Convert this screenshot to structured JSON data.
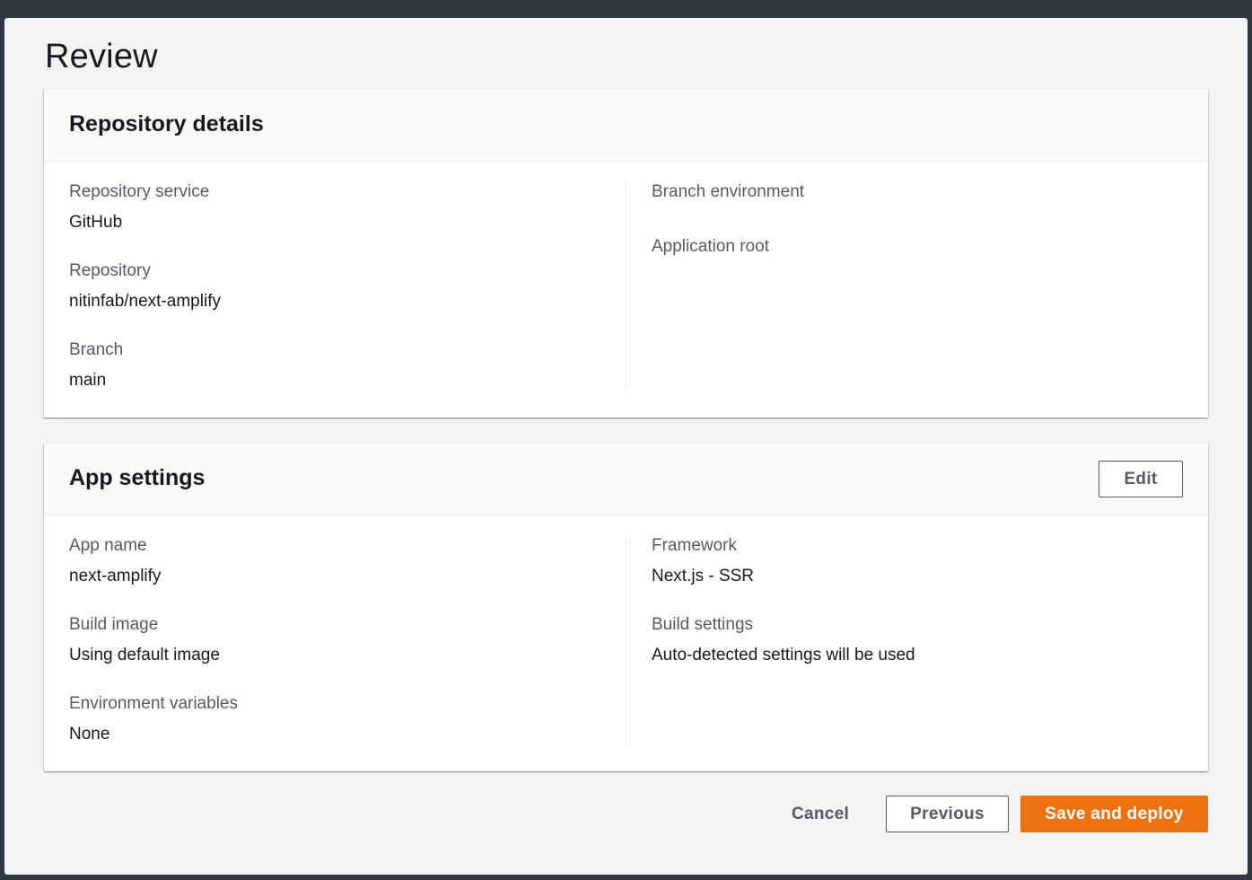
{
  "page": {
    "title": "Review"
  },
  "repository_details": {
    "title": "Repository details",
    "left": [
      {
        "label": "Repository service",
        "value": "GitHub"
      },
      {
        "label": "Repository",
        "value": "nitinfab/next-amplify"
      },
      {
        "label": "Branch",
        "value": "main"
      }
    ],
    "right": [
      {
        "label": "Branch environment",
        "value": ""
      },
      {
        "label": "Application root",
        "value": ""
      }
    ]
  },
  "app_settings": {
    "title": "App settings",
    "edit_label": "Edit",
    "left": [
      {
        "label": "App name",
        "value": "next-amplify"
      },
      {
        "label": "Build image",
        "value": "Using default image"
      },
      {
        "label": "Environment variables",
        "value": "None"
      }
    ],
    "right": [
      {
        "label": "Framework",
        "value": "Next.js - SSR"
      },
      {
        "label": "Build settings",
        "value": "Auto-detected settings will be used"
      }
    ]
  },
  "footer": {
    "cancel_label": "Cancel",
    "previous_label": "Previous",
    "primary_label": "Save and deploy"
  },
  "colors": {
    "primary": "#ec7211",
    "text": "#16191f",
    "label": "#545b64",
    "frame": "#2f3841",
    "background": "#f2f3f3"
  }
}
